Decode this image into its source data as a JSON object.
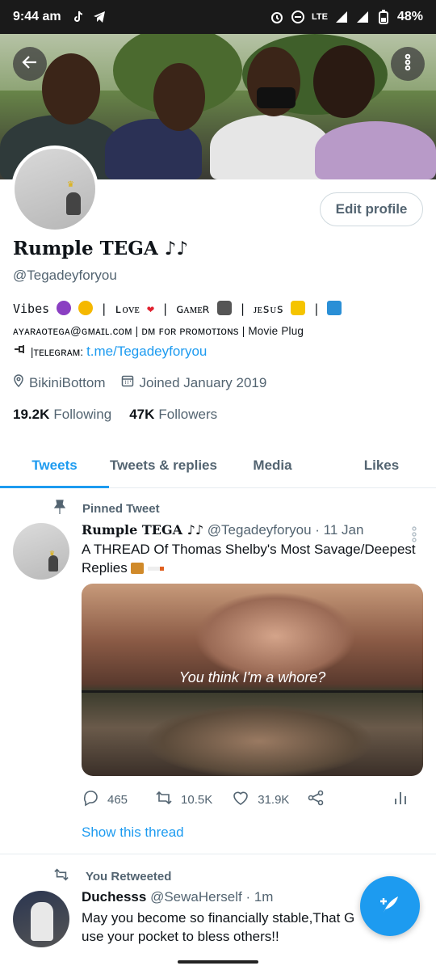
{
  "status_bar": {
    "time": "9:44 am",
    "battery": "48%",
    "network": "LTE"
  },
  "header": {
    "back_icon": "arrow-left-icon",
    "more_icon": "vertical-dots-icon"
  },
  "profile": {
    "display_name": "Rumple TEGA ♪♪",
    "handle": "@Tegadeyforyou",
    "edit_button_label": "Edit profile",
    "bio_line1_a": "Vibes ",
    "bio_line1_b": "| ʟᴏᴠᴇ ",
    "bio_line1_c": " | ɢᴀᴍᴇʀ ",
    "bio_line1_d": " | ᴊᴇsᴜs ",
    "bio_line1_e": " | ",
    "bio_line2": "ᴀʏᴀʀᴀᴏᴛᴇɢᴀ@ɢᴍᴀɪʟ.ᴄᴏᴍ | ᴅᴍ ꜰᴏʀ ᴘʀᴏᴍᴏᴛɪᴏɴs | Movie Plug",
    "bio_line3_prefix": " |ᴛᴇʟᴇɢʀᴀᴍ:",
    "bio_link": "t.me/Tegadeyforyou",
    "location": "BikiniBottom",
    "joined": "Joined January 2019",
    "following_count": "19.2K",
    "following_label": "Following",
    "followers_count": "47K",
    "followers_label": "Followers"
  },
  "tabs": [
    {
      "label": "Tweets",
      "active": true
    },
    {
      "label": "Tweets & replies",
      "active": false
    },
    {
      "label": "Media",
      "active": false
    },
    {
      "label": "Likes",
      "active": false
    }
  ],
  "pinned_tweet": {
    "pinned_label": "Pinned Tweet",
    "author": "Rumple TEGA ♪♪",
    "handle": "@Tegadeyforyou",
    "date": "· 11 Jan",
    "text": "A THREAD Of Thomas Shelby's Most Savage/Deepest Replies",
    "media_caption": "You think I'm a whore?",
    "replies": "465",
    "retweets": "10.5K",
    "likes": "31.9K",
    "show_thread": "Show this thread"
  },
  "retweet": {
    "retweet_label": "You Retweeted",
    "author": "Duchesss",
    "handle": "@SewaHerself",
    "date": "· 1m",
    "text": "May you become so financially stable,That G",
    "text_line2": "use your pocket to bless others!!"
  },
  "colors": {
    "accent": "#1d9bf0",
    "muted": "#536471",
    "text": "#0f1419"
  }
}
